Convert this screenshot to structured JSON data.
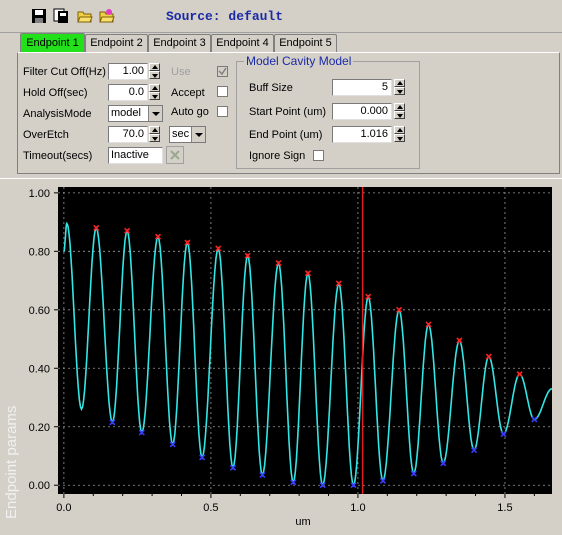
{
  "toolbar": {
    "icons": [
      "save-icon",
      "copy-icon",
      "open-folder-icon",
      "open-folder-star-icon"
    ],
    "source_label": "Source: default"
  },
  "tabs": [
    {
      "label": "Endpoint 1",
      "active": true
    },
    {
      "label": "Endpoint 2",
      "active": false
    },
    {
      "label": "Endpoint 3",
      "active": false
    },
    {
      "label": "Endpoint 4",
      "active": false
    },
    {
      "label": "Endpoint 5",
      "active": false
    }
  ],
  "form": {
    "filter_cutoff_label": "Filter Cut Off(Hz)",
    "filter_cutoff_value": "1.00",
    "hold_off_label": "Hold Off(sec)",
    "hold_off_value": "0.0",
    "analysis_mode_label": "AnalysisMode",
    "analysis_mode_value": "model",
    "overetch_label": "OverEtch",
    "overetch_value": "70.0",
    "overetch_unit": "sec",
    "timeout_label": "Timeout(secs)",
    "timeout_value": "Inactive",
    "use_label": "Use",
    "accept_label": "Accept",
    "auto_go_label": "Auto go"
  },
  "model_cavity": {
    "title": "Model Cavity Model",
    "buff_size_label": "Buff Size",
    "buff_size_value": "5",
    "start_point_label": "Start Point (um)",
    "start_point_value": "0.000",
    "end_point_label": "End Point (um)",
    "end_point_value": "1.016",
    "ignore_sign_label": "Ignore Sign"
  },
  "colors": {
    "active_tab": "#22e01a",
    "plot_bg": "#000000",
    "trace": "#33e6e6",
    "max_marker": "#ff2020",
    "min_marker": "#3a3aff",
    "end_line": "#e02020"
  },
  "chart_data": {
    "type": "line",
    "ylabel": "Endpoint params",
    "xlabel": "um",
    "xlim": [
      -0.02,
      1.66
    ],
    "ylim": [
      -0.03,
      1.02
    ],
    "xticks": [
      "0.0",
      "0.5",
      "1.0",
      "1.5"
    ],
    "xtick_values": [
      0.0,
      0.5,
      1.0,
      1.5
    ],
    "yticks": [
      "0.00",
      "0.20",
      "0.40",
      "0.60",
      "0.80",
      "1.00"
    ],
    "ytick_values": [
      0.0,
      0.2,
      0.4,
      0.6,
      0.8,
      1.0
    ],
    "grid": true,
    "end_point_line_x": 1.016,
    "maxima": [
      {
        "x": 0.11,
        "y": 0.88
      },
      {
        "x": 0.215,
        "y": 0.87
      },
      {
        "x": 0.32,
        "y": 0.85
      },
      {
        "x": 0.42,
        "y": 0.83
      },
      {
        "x": 0.525,
        "y": 0.81
      },
      {
        "x": 0.625,
        "y": 0.785
      },
      {
        "x": 0.73,
        "y": 0.76
      },
      {
        "x": 0.83,
        "y": 0.725
      },
      {
        "x": 0.935,
        "y": 0.69
      },
      {
        "x": 1.035,
        "y": 0.645
      },
      {
        "x": 1.14,
        "y": 0.6
      },
      {
        "x": 1.24,
        "y": 0.55
      },
      {
        "x": 1.345,
        "y": 0.495
      },
      {
        "x": 1.445,
        "y": 0.44
      },
      {
        "x": 1.55,
        "y": 0.38
      }
    ],
    "minima": [
      {
        "x": 0.165,
        "y": 0.215
      },
      {
        "x": 0.265,
        "y": 0.18
      },
      {
        "x": 0.37,
        "y": 0.14
      },
      {
        "x": 0.47,
        "y": 0.095
      },
      {
        "x": 0.575,
        "y": 0.06
      },
      {
        "x": 0.675,
        "y": 0.035
      },
      {
        "x": 0.78,
        "y": 0.01
      },
      {
        "x": 0.88,
        "y": 0.0
      },
      {
        "x": 0.985,
        "y": 0.0
      },
      {
        "x": 1.085,
        "y": 0.015
      },
      {
        "x": 1.19,
        "y": 0.04
      },
      {
        "x": 1.29,
        "y": 0.075
      },
      {
        "x": 1.395,
        "y": 0.12
      },
      {
        "x": 1.495,
        "y": 0.175
      },
      {
        "x": 1.6,
        "y": 0.225
      }
    ],
    "start": {
      "x": 0.0,
      "y": 0.8
    },
    "first_peak": {
      "x": 0.01,
      "y": 0.895
    },
    "first_min": {
      "x": 0.06,
      "y": 0.26
    },
    "end": {
      "x": 1.66,
      "y": 0.33
    }
  }
}
